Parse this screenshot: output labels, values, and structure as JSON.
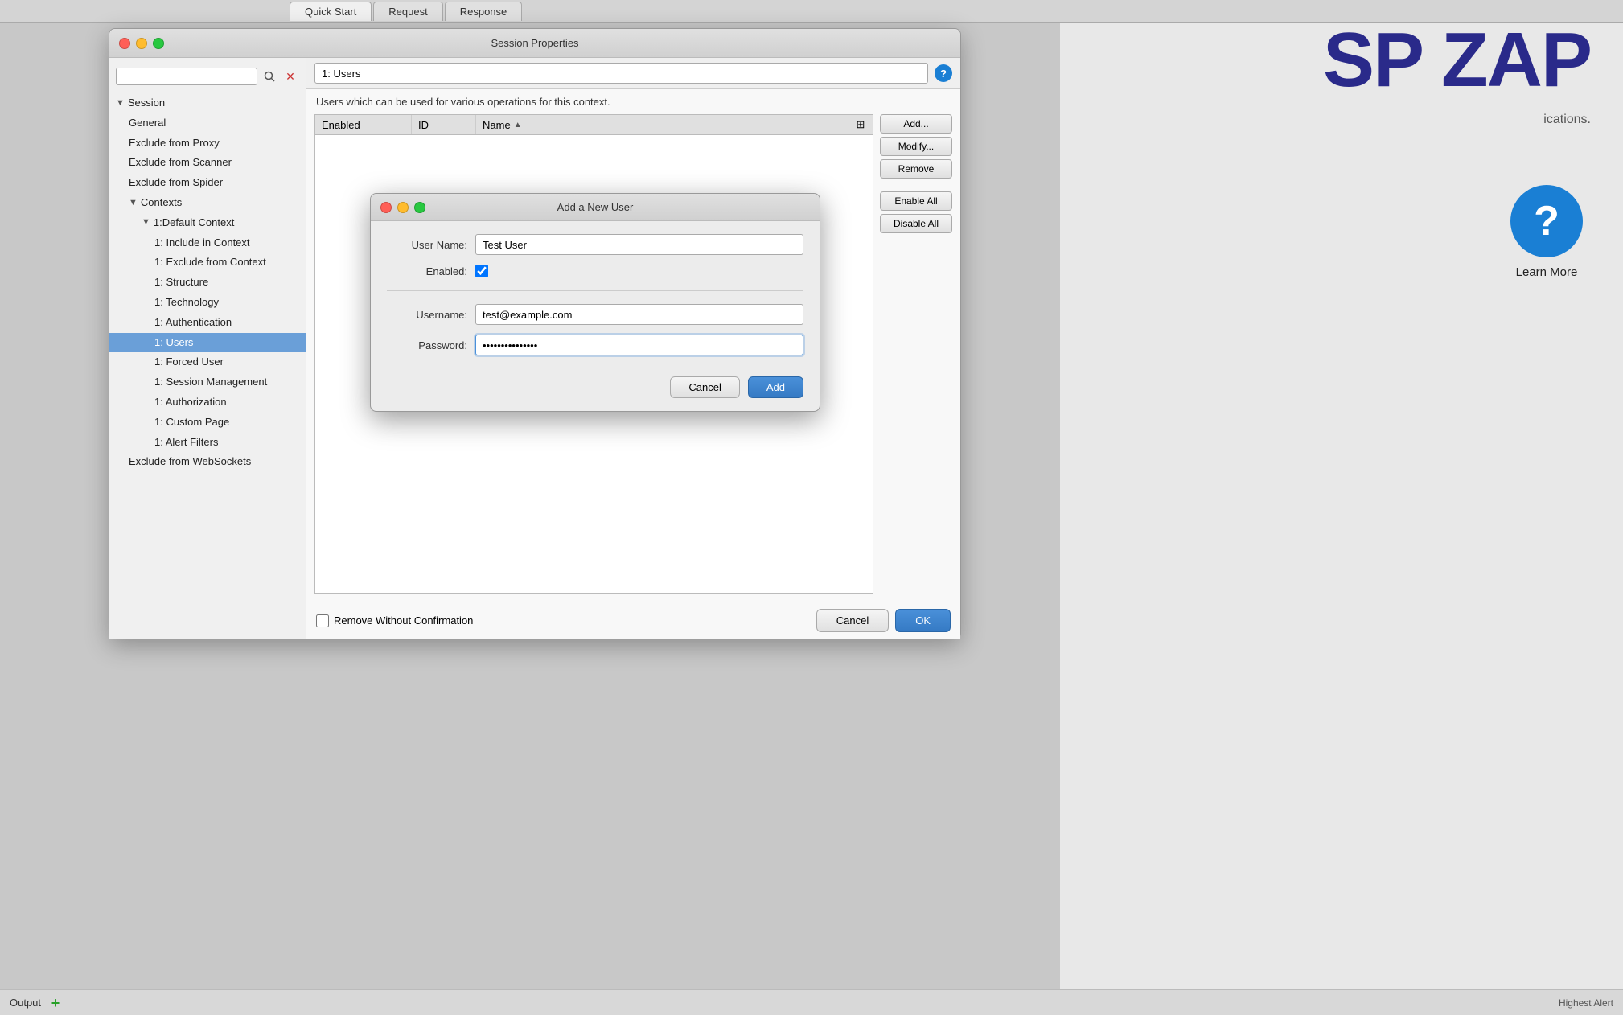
{
  "app": {
    "title": "SP ZAP",
    "subtitle": "ications."
  },
  "tabs": [
    {
      "label": "Quick Start",
      "active": true
    },
    {
      "label": "Request",
      "active": false
    },
    {
      "label": "Response",
      "active": false
    }
  ],
  "sessionDialog": {
    "title": "Session Properties",
    "contextTitle": "1: Users",
    "description": "Users which can be used for various operations for this context.",
    "tableHeaders": [
      "Enabled",
      "ID",
      "Name",
      ""
    ],
    "sortColumn": "Name",
    "buttons": {
      "add": "Add...",
      "modify": "Modify...",
      "remove": "Remove",
      "enableAll": "Enable All",
      "disableAll": "Disable All"
    },
    "bottomCheckbox": "Remove Without Confirmation",
    "cancelBtn": "Cancel",
    "okBtn": "OK"
  },
  "sidebar": {
    "searchPlaceholder": "",
    "items": [
      {
        "label": "Session",
        "level": 0,
        "type": "group",
        "expanded": true
      },
      {
        "label": "General",
        "level": 1,
        "type": "item"
      },
      {
        "label": "Exclude from Proxy",
        "level": 1,
        "type": "item"
      },
      {
        "label": "Exclude from Scanner",
        "level": 1,
        "type": "item"
      },
      {
        "label": "Exclude from Spider",
        "level": 1,
        "type": "item"
      },
      {
        "label": "Contexts",
        "level": 1,
        "type": "group",
        "expanded": true
      },
      {
        "label": "1:Default Context",
        "level": 2,
        "type": "group",
        "expanded": true
      },
      {
        "label": "1: Include in Context",
        "level": 3,
        "type": "item"
      },
      {
        "label": "1: Exclude from Context",
        "level": 3,
        "type": "item"
      },
      {
        "label": "1: Structure",
        "level": 3,
        "type": "item"
      },
      {
        "label": "1: Technology",
        "level": 3,
        "type": "item"
      },
      {
        "label": "1: Authentication",
        "level": 3,
        "type": "item"
      },
      {
        "label": "1: Users",
        "level": 3,
        "type": "item",
        "selected": true
      },
      {
        "label": "1: Forced User",
        "level": 3,
        "type": "item"
      },
      {
        "label": "1: Session Management",
        "level": 3,
        "type": "item"
      },
      {
        "label": "1: Authorization",
        "level": 3,
        "type": "item"
      },
      {
        "label": "1: Custom Page",
        "level": 3,
        "type": "item"
      },
      {
        "label": "1: Alert Filters",
        "level": 3,
        "type": "item"
      },
      {
        "label": "Exclude from WebSockets",
        "level": 1,
        "type": "item"
      }
    ]
  },
  "addUserDialog": {
    "title": "Add a New User",
    "fields": {
      "userName": {
        "label": "User Name:",
        "value": "Test User"
      },
      "enabled": {
        "label": "Enabled:",
        "checked": true
      },
      "username": {
        "label": "Username:",
        "value": "test@example.com"
      },
      "password": {
        "label": "Password:",
        "value": "············"
      }
    },
    "cancelBtn": "Cancel",
    "addBtn": "Add"
  },
  "learnMore": {
    "label": "Learn More"
  },
  "outputBar": {
    "label": "Output",
    "statusRight": "Highest Alert"
  }
}
